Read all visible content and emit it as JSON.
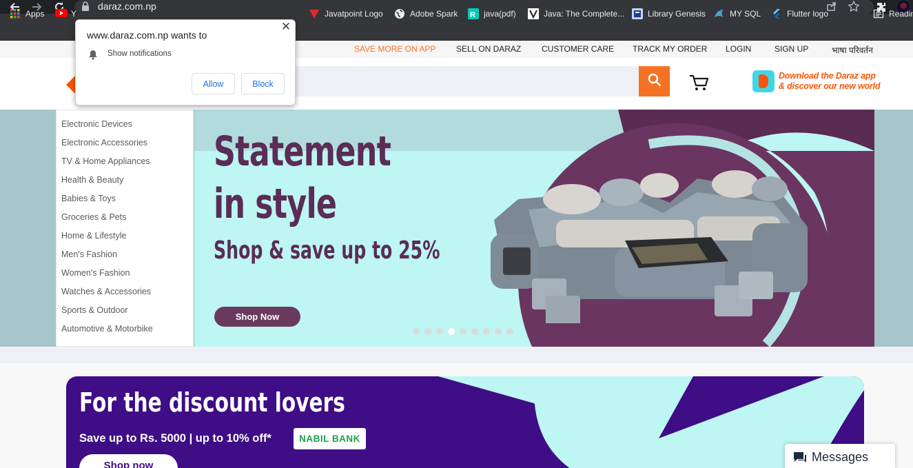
{
  "browser": {
    "url": "daraz.com.np",
    "icons": [
      "back-icon",
      "forward-icon",
      "reload-icon",
      "lock-icon",
      "share-icon",
      "star-icon",
      "extensions-icon",
      "profile-avatar"
    ],
    "bookmarks": [
      {
        "label": "Apps",
        "icon": "apps-grid-icon"
      },
      {
        "label": "Y",
        "icon": "youtube-icon"
      },
      {
        "label": "Javatpoint Logo",
        "icon": "javatpoint-icon"
      },
      {
        "label": "Adobe Spark",
        "icon": "globe-icon"
      },
      {
        "label": "java(pdf)",
        "icon": "researchgate-icon"
      },
      {
        "label": "Java: The Complete...",
        "icon": "v-icon"
      },
      {
        "label": "Library Genesis",
        "icon": "library-icon"
      },
      {
        "label": "MY SQL",
        "icon": "mysql-icon"
      },
      {
        "label": "Flutter logo",
        "icon": "flutter-icon"
      },
      {
        "label": "Readin",
        "icon": "reading-list-icon"
      }
    ]
  },
  "notification": {
    "title": "www.daraz.com.np wants to",
    "message": "Show notifications",
    "allow_label": "Allow",
    "block_label": "Block",
    "close_symbol": "✕"
  },
  "topbar": {
    "links": [
      "SAVE MORE ON APP",
      "SELL ON DARAZ",
      "CUSTOMER CARE",
      "TRACK MY ORDER",
      "LOGIN",
      "SIGN UP",
      "भाषा परिवर्तन"
    ],
    "highlight_color": "#f57224"
  },
  "header": {
    "app_promo_line1": "Download the Daraz app",
    "app_promo_line2": "& discover our new world",
    "accent": "#f57224"
  },
  "categories": [
    "Electronic Devices",
    "Electronic Accessories",
    "TV & Home Appliances",
    "Health & Beauty",
    "Babies & Toys",
    "Groceries & Pets",
    "Home & Lifestyle",
    "Men's Fashion",
    "Women's Fashion",
    "Watches & Accessories",
    "Sports & Outdoor",
    "Automotive & Motorbike"
  ],
  "hero": {
    "line1": "Statement",
    "line2": "in style",
    "line3": "Shop & save up to 25%",
    "cta": "Shop Now",
    "slide_count": 9,
    "active_slide": 4,
    "colors": {
      "bg": "#bdf6f2",
      "text": "#5b2c56",
      "shape": "#6b3561"
    }
  },
  "discount": {
    "heading": "For the discount lovers",
    "sub": "Save up to Rs. 5000 | up to 10% off*",
    "bank": "NABIL BANK",
    "cta": "Shop now",
    "colors": {
      "bg": "#3f0d86",
      "accent_shape": "#bdf6f2"
    }
  },
  "messages": {
    "label": "Messages"
  }
}
